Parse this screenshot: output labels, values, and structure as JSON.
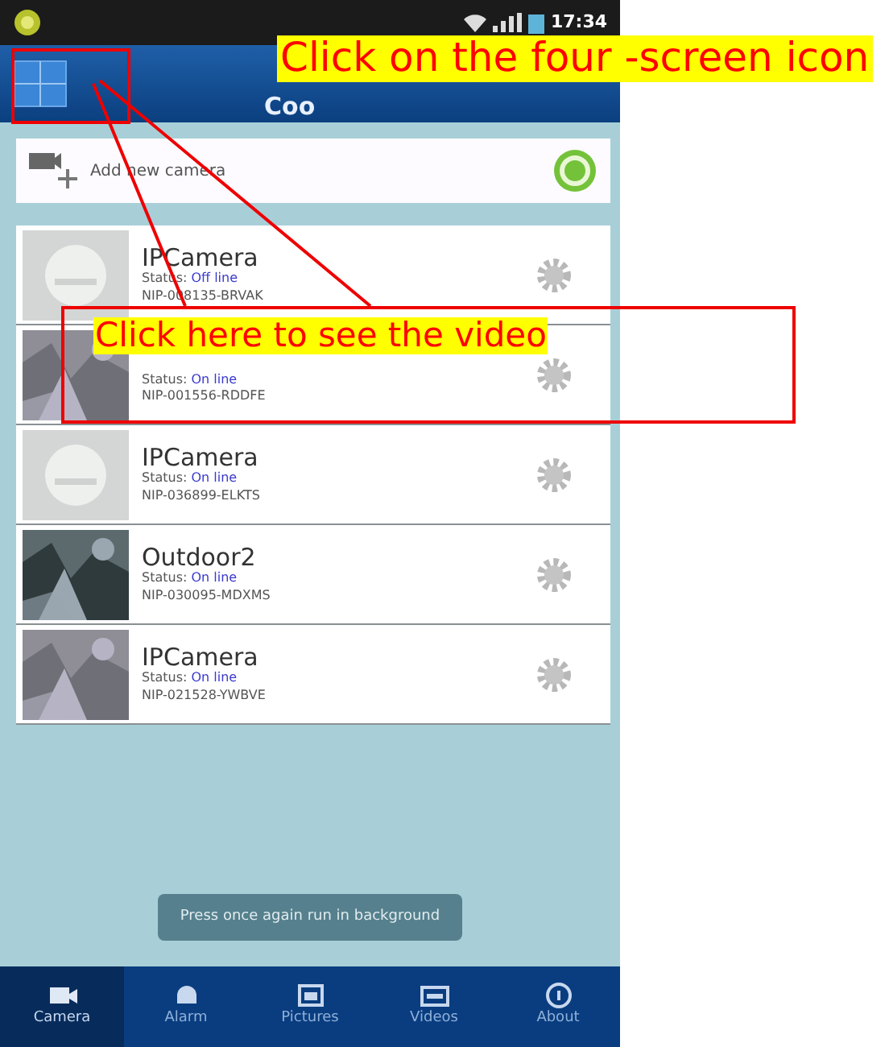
{
  "status_bar": {
    "time": "17:34"
  },
  "header": {
    "title": "Coo"
  },
  "add_camera": {
    "label": "Add new camera"
  },
  "cameras": [
    {
      "name": "IPCamera",
      "status_label": "Status:",
      "status": "Off line",
      "uid": "NIP-008135-BRVAK",
      "kind": "placeholder"
    },
    {
      "status_label": "Status:",
      "status": "On line",
      "uid": "NIP-001556-RDDFE",
      "kind": "picture"
    },
    {
      "name": "IPCamera",
      "status_label": "Status:",
      "status": "On line",
      "uid": "NIP-036899-ELKTS",
      "kind": "placeholder"
    },
    {
      "name": "Outdoor2",
      "status_label": "Status:",
      "status": "On line",
      "uid": "NIP-030095-MDXMS",
      "kind": "picture"
    },
    {
      "name": "IPCamera",
      "status_label": "Status:",
      "status": "On line",
      "uid": "NIP-021528-YWBVE",
      "kind": "picture"
    }
  ],
  "toast": "Press once again run in background",
  "tabs": [
    {
      "label": "Camera",
      "selected": true
    },
    {
      "label": "Alarm",
      "selected": false
    },
    {
      "label": "Pictures",
      "selected": false
    },
    {
      "label": "Videos",
      "selected": false
    },
    {
      "label": "About",
      "selected": false
    }
  ],
  "annotations": [
    {
      "text": "Click on the four -screen icon"
    },
    {
      "text": "Click here to see the video"
    }
  ]
}
